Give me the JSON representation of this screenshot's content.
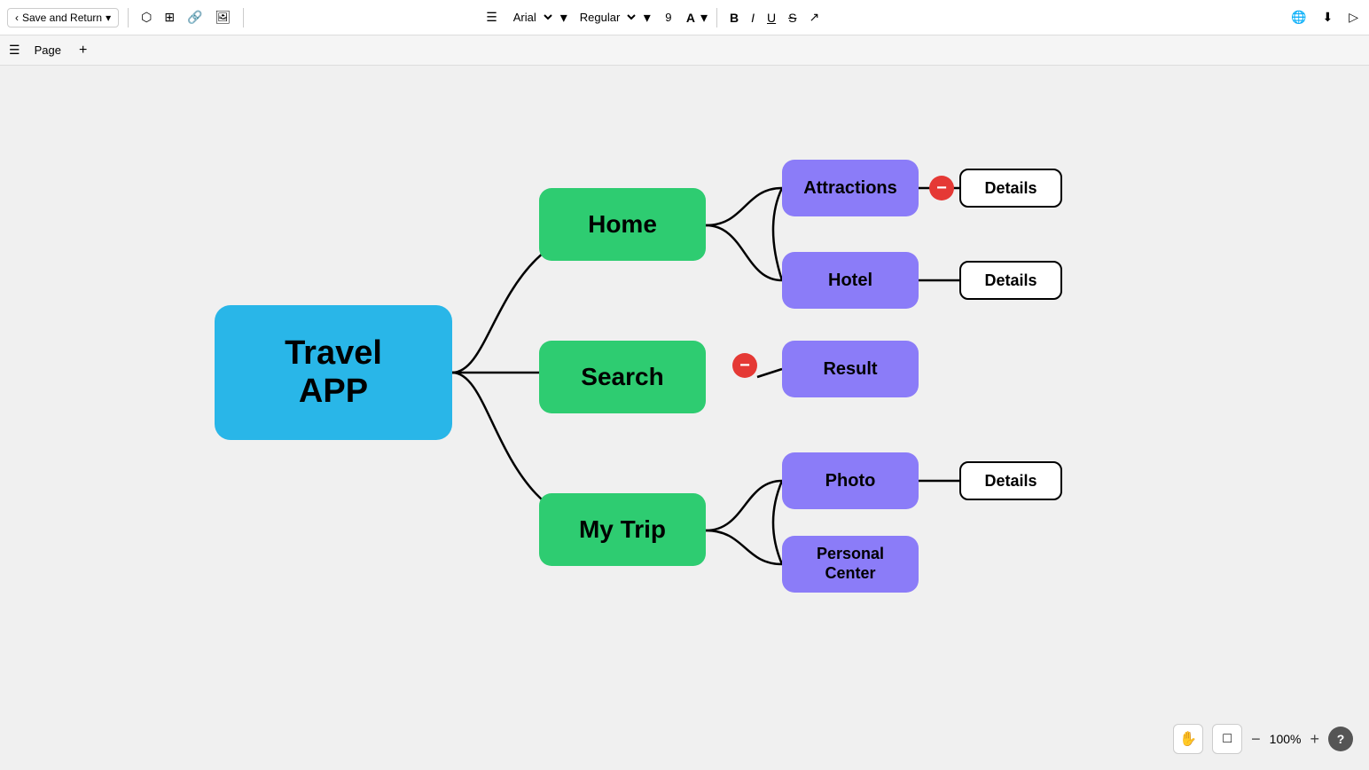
{
  "toolbar": {
    "save_return": "Save and Return",
    "font_family": "Arial",
    "font_style": "Regular",
    "font_size": "9",
    "icons": {
      "back": "‹",
      "dropdown": "▾",
      "shape1": "⬡",
      "shape2": "⊞",
      "link": "🔗",
      "image": "🖼",
      "filter": "☰",
      "bold": "B",
      "italic": "I",
      "underline": "U",
      "strikethrough": "S",
      "export": "↗",
      "download": "⬇",
      "play": "▷",
      "globe": "🌐",
      "text_color": "A"
    }
  },
  "page_bar": {
    "page_label": "Page",
    "add_label": "+"
  },
  "nodes": {
    "travel_app": "Travel\nAPP",
    "home": "Home",
    "search": "Search",
    "my_trip": "My Trip",
    "attractions": "Attractions",
    "hotel": "Hotel",
    "result": "Result",
    "photo": "Photo",
    "personal_center": "Personal\nCenter",
    "details": "Details"
  },
  "bottom": {
    "zoom_level": "100%",
    "zoom_minus": "−",
    "zoom_plus": "+"
  }
}
